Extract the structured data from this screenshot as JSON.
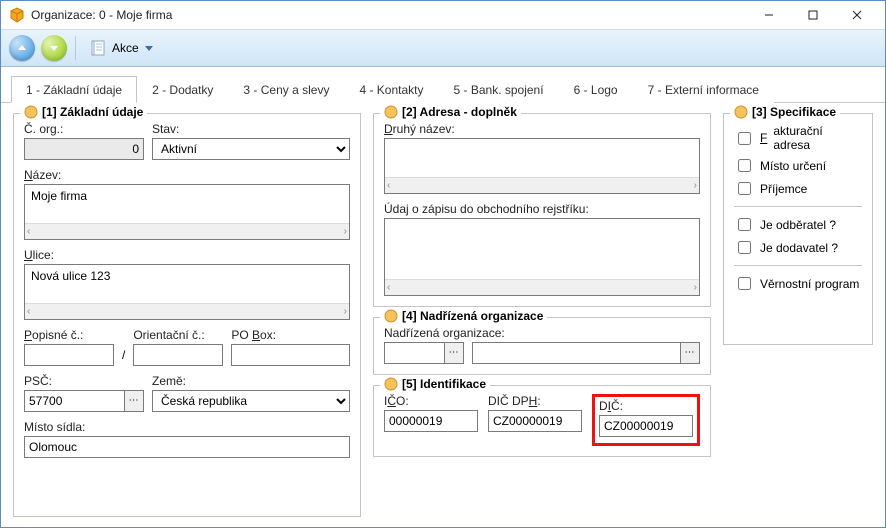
{
  "window": {
    "title": "Organizace: 0 - Moje firma"
  },
  "toolbar": {
    "akce_label": "Akce"
  },
  "tabs": [
    {
      "label": "1 - Základní údaje",
      "active": true
    },
    {
      "label": "2 - Dodatky"
    },
    {
      "label": "3 - Ceny a slevy"
    },
    {
      "label": "4 - Kontakty"
    },
    {
      "label": "5 - Bank. spojení"
    },
    {
      "label": "6 - Logo"
    },
    {
      "label": "7 - Externí informace"
    }
  ],
  "g1": {
    "title": "[1] Základní údaje",
    "c_org_label": "Č. org.:",
    "c_org_value": "0",
    "stav_label": "Stav:",
    "stav_value": "Aktivní",
    "nazev_label": "Název:",
    "nazev_value": "Moje firma",
    "ulice_label": "Ulice:",
    "ulice_value": "Nová ulice 123",
    "popisne_label": "Popisné č.:",
    "slash": "/",
    "orientacni_label": "Orientační č.:",
    "pobox_label": "PO Box:",
    "psc_label": "PSČ:",
    "psc_value": "57700",
    "zeme_label": "Země:",
    "zeme_value": "Česká republika",
    "misto_label": "Místo sídla:",
    "misto_value": "Olomouc"
  },
  "g2": {
    "title": "[2] Adresa - doplněk",
    "druhy_label": "Druhý název:",
    "rejstrik_label": "Údaj o zápisu do obchodního rejstříku:"
  },
  "g3": {
    "title": "[3] Specifikace",
    "fakturacni": "Fakturační adresa",
    "misto_urceni": "Místo určení",
    "prijemce": "Příjemce",
    "odberatel": "Je odběratel ?",
    "dodavatel": "Je dodavatel ?",
    "vernostni": "Věrnostní program"
  },
  "g4": {
    "title": "[4] Nadřízená organizace",
    "nadrizena_label": "Nadřízená organizace:"
  },
  "g5": {
    "title": "[5] Identifikace",
    "ico_label": "IČO:",
    "ico_value": "00000019",
    "dic_dph_label": "DIČ DPH:",
    "dic_dph_value": "CZ00000019",
    "dic_label": "DIČ:",
    "dic_value": "CZ00000019"
  }
}
